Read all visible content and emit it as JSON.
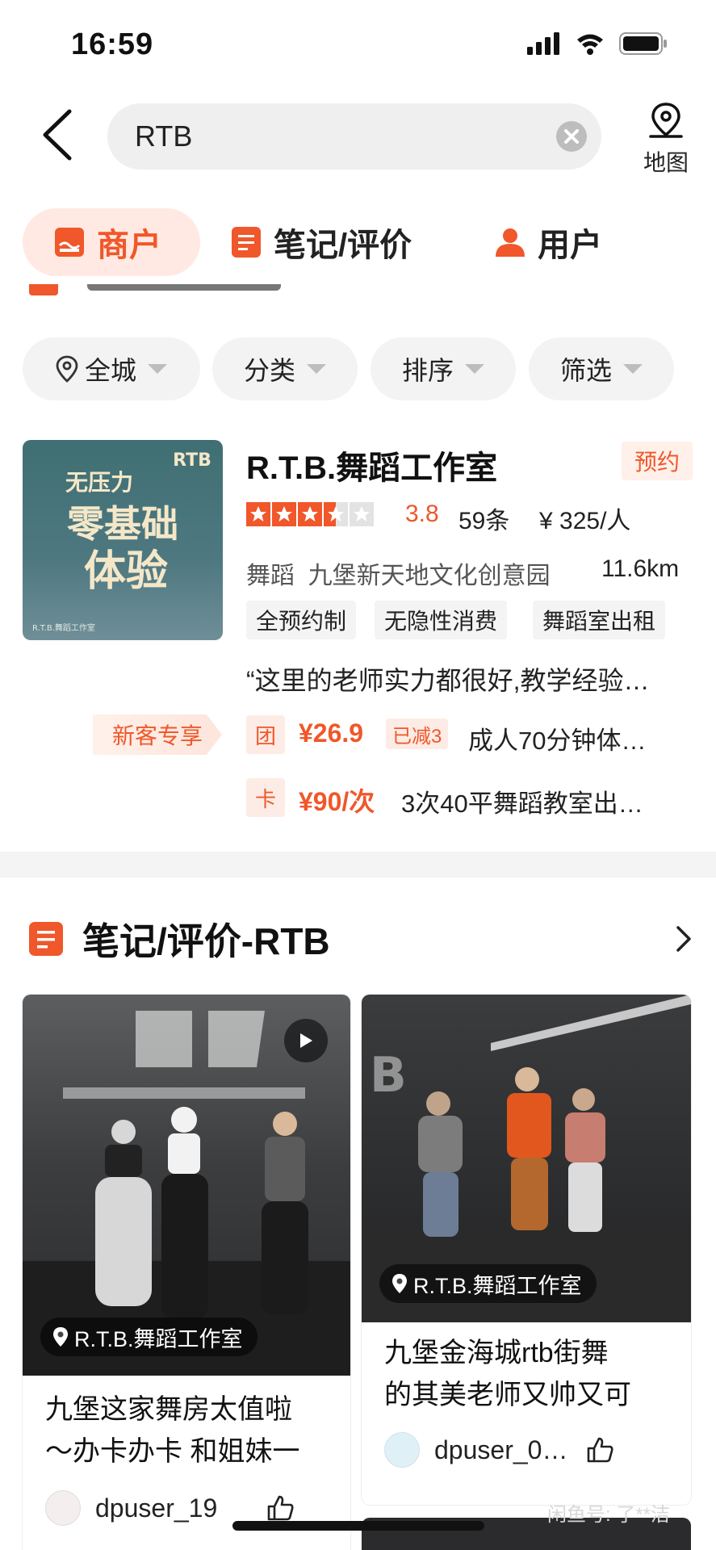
{
  "status_bar": {
    "time": "16:59"
  },
  "search": {
    "query": "RTB",
    "map_label": "地图"
  },
  "tabs": [
    {
      "label": "商户",
      "active": true
    },
    {
      "label": "笔记/评价",
      "active": false
    },
    {
      "label": "用户",
      "active": false
    }
  ],
  "filters": [
    "全城",
    "分类",
    "排序",
    "筛选"
  ],
  "merchant": {
    "thumb_text": {
      "line1": "无压力",
      "line2": "零基础",
      "line3": "体验",
      "logo": "RTB",
      "caption": "R.T.B.舞蹈工作室"
    },
    "name": "R.T.B.舞蹈工作室",
    "badge": "预约",
    "rating_value": 3.8,
    "rating": "3.8",
    "reviews": "59条",
    "price": "¥ 325/人",
    "category": "舞蹈",
    "area": "九堡新天地文化创意园",
    "distance": "11.6km",
    "tags": [
      "全预约制",
      "无隐性消费",
      "舞蹈室出租"
    ],
    "quote": "“这里的老师实力都很好,教学经验…",
    "new_customer": "新客专享",
    "deals": [
      {
        "icon": "团",
        "price": "¥26.9",
        "discount": "已减3",
        "text": "成人70分钟体…"
      },
      {
        "icon": "卡",
        "price": "¥90/次",
        "text": "3次40平舞蹈教室出…"
      }
    ]
  },
  "notes": {
    "heading": "笔记/评价-RTB",
    "items": [
      {
        "location": "R.T.B.舞蹈工作室",
        "title_line1": "九堡这家舞房太值啦",
        "title_line2": "～办卡办卡 和姐妹一",
        "author": "dpuser_19"
      },
      {
        "location": "R.T.B.舞蹈工作室",
        "title_line1": "九堡金海城rtb街舞",
        "title_line2": "的其美老师又帅又可",
        "author": "dpuser_0…"
      }
    ]
  },
  "watermark": "闲鱼号: 了**洁",
  "colors": {
    "accent": "#f0572a",
    "accent_bg": "#ffe9e2"
  }
}
